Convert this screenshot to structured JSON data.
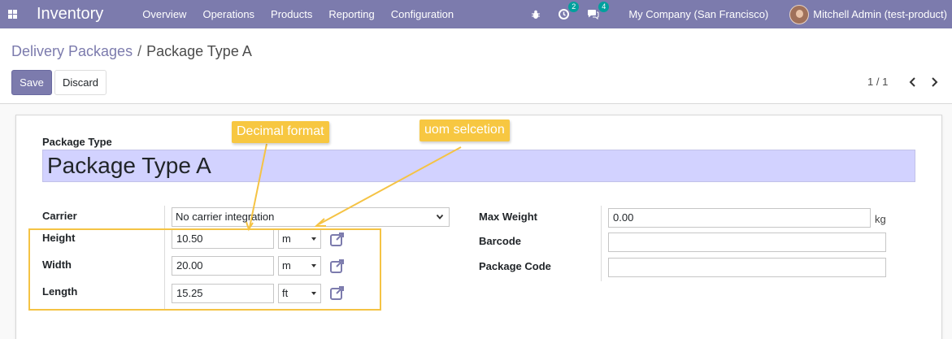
{
  "navbar": {
    "app_title": "Inventory",
    "menu": [
      "Overview",
      "Operations",
      "Products",
      "Reporting",
      "Configuration"
    ],
    "activity_badge": "2",
    "messages_badge": "4",
    "company": "My Company (San Francisco)",
    "user": "Mitchell Admin (test-product)"
  },
  "breadcrumb": {
    "parent": "Delivery Packages",
    "separator": "/",
    "current": "Package Type A"
  },
  "buttons": {
    "save": "Save",
    "discard": "Discard"
  },
  "pager": {
    "value": "1 / 1"
  },
  "form": {
    "title_label": "Package Type",
    "name": "Package Type A",
    "carrier_label": "Carrier",
    "carrier_value": "No carrier integration",
    "height_label": "Height",
    "height_value": "10.50",
    "height_uom": "m",
    "width_label": "Width",
    "width_value": "20.00",
    "width_uom": "m",
    "length_label": "Length",
    "length_value": "15.25",
    "length_uom": "ft",
    "max_weight_label": "Max Weight",
    "max_weight_value": "0.00",
    "max_weight_unit": "kg",
    "barcode_label": "Barcode",
    "barcode_value": "",
    "package_code_label": "Package Code",
    "package_code_value": ""
  },
  "annotations": {
    "decimal_format": "Decimal format",
    "uom_selection": "uom selcetion"
  },
  "colors": {
    "primary": "#7c7bad",
    "highlight_field": "#d2d2ff",
    "annotation": "#f7c741",
    "badge": "#00a09d"
  }
}
